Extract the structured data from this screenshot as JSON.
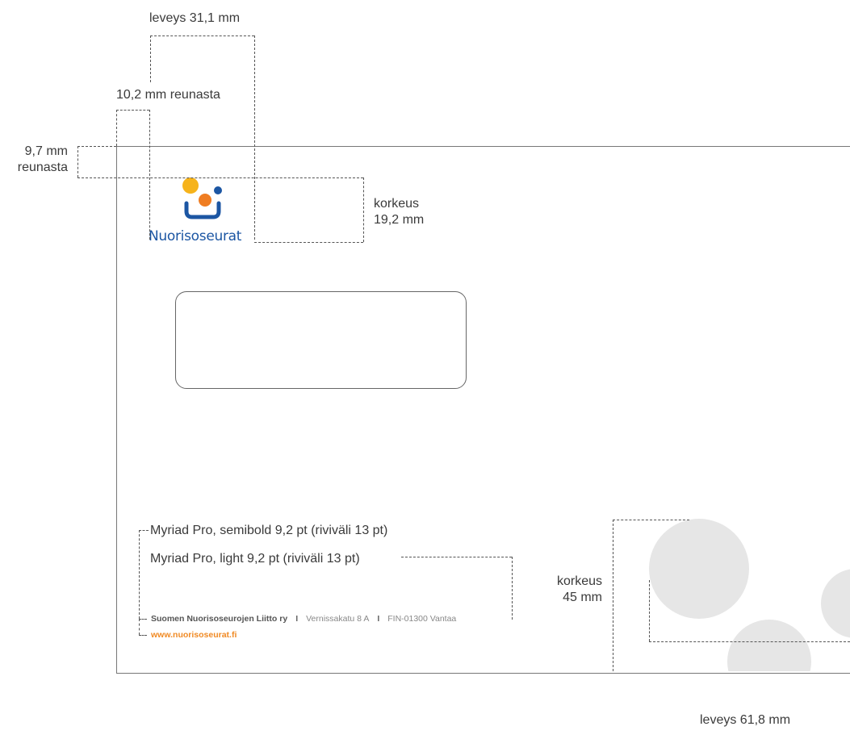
{
  "dimensions": {
    "logo_width": "leveys 31,1 mm",
    "logo_left_margin": "10,2 mm reunasta",
    "logo_top_margin_line1": "9,7 mm",
    "logo_top_margin_line2": "reunasta",
    "logo_height_line1": "korkeus",
    "logo_height_line2": "19,2 mm",
    "circles_height_line1": "korkeus",
    "circles_height_line2": "45 mm",
    "circles_width": "leveys 61,8 mm"
  },
  "logo": {
    "text": "Nuorisoseurat",
    "colors": {
      "yellow": "#f6b31b",
      "orange": "#ef7d22",
      "blue": "#1c56a3"
    }
  },
  "typography_notes": {
    "semibold": "Myriad Pro, semibold 9,2 pt (riviväli 13 pt)",
    "light": "Myriad Pro, light 9,2 pt (riviväli 13 pt)"
  },
  "footer": {
    "org_name": "Suomen Nuorisoseurojen Liitto ry",
    "separator": "I",
    "street": "Vernissakatu 8 A",
    "postal": "FIN-01300 Vantaa",
    "url": "www.nuorisoseurat.fi"
  },
  "colors": {
    "circle_gray": "#e6e6e6",
    "url_orange": "#f08a24"
  }
}
